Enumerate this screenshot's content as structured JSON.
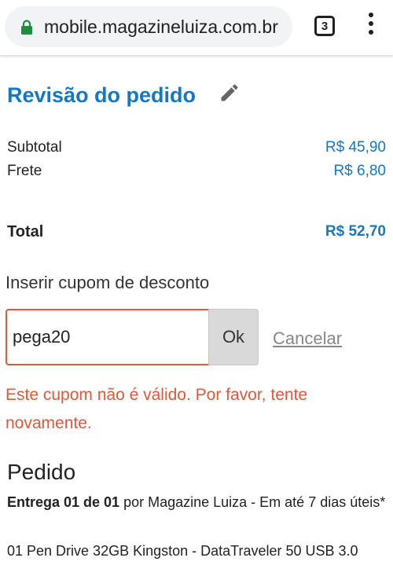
{
  "browser": {
    "url": "mobile.magazineluiza.com.br",
    "tab_count": "3",
    "icons": {
      "lock": "lock-icon",
      "menu": "more-vert-icon"
    },
    "lock_color": "#1e8e3e"
  },
  "review": {
    "title": "Revisão do pedido",
    "edit_icon": "pencil-icon",
    "subtotal_label": "Subtotal",
    "subtotal_value": "R$ 45,90",
    "frete_label": "Frete",
    "frete_value": "R$ 6,80",
    "total_label": "Total",
    "total_value": "R$ 52,70"
  },
  "coupon": {
    "label": "Inserir cupom de desconto",
    "value": "pega20",
    "ok_label": "Ok",
    "cancel_label": "Cancelar",
    "error": "Este cupom não é válido. Por favor, tente novamente."
  },
  "order": {
    "title": "Pedido",
    "delivery_strong": "Entrega 01 de 01",
    "delivery_rest": " por Magazine Luiza - Em até 7 dias úteis*",
    "product": "01 Pen Drive 32GB Kingston - DataTraveler 50 USB 3.0"
  },
  "colors": {
    "accent": "#1478c5",
    "error": "#e05a3a"
  }
}
